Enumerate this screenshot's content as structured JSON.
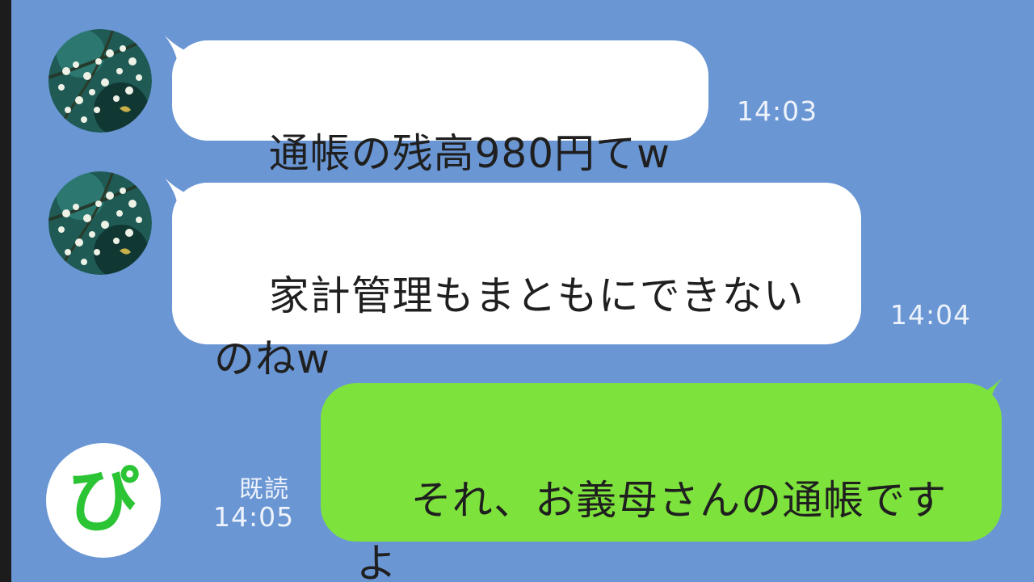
{
  "theme": {
    "chat_background": "#6a96d4",
    "incoming_bubble": "#ffffff",
    "outgoing_bubble": "#7ee23c",
    "logo_green": "#2bc434"
  },
  "messages": [
    {
      "side": "incoming",
      "text": "通帳の残高980円てw",
      "time": "14:03"
    },
    {
      "side": "incoming",
      "text": "家計管理もまともにできない\nのねw",
      "time": "14:04"
    },
    {
      "side": "outgoing",
      "text": "それ、お義母さんの通帳です\nよ",
      "time": "14:05",
      "read_label": "既読"
    }
  ],
  "logo": {
    "char": "ぴ",
    "icon": "pi-logo-icon"
  }
}
